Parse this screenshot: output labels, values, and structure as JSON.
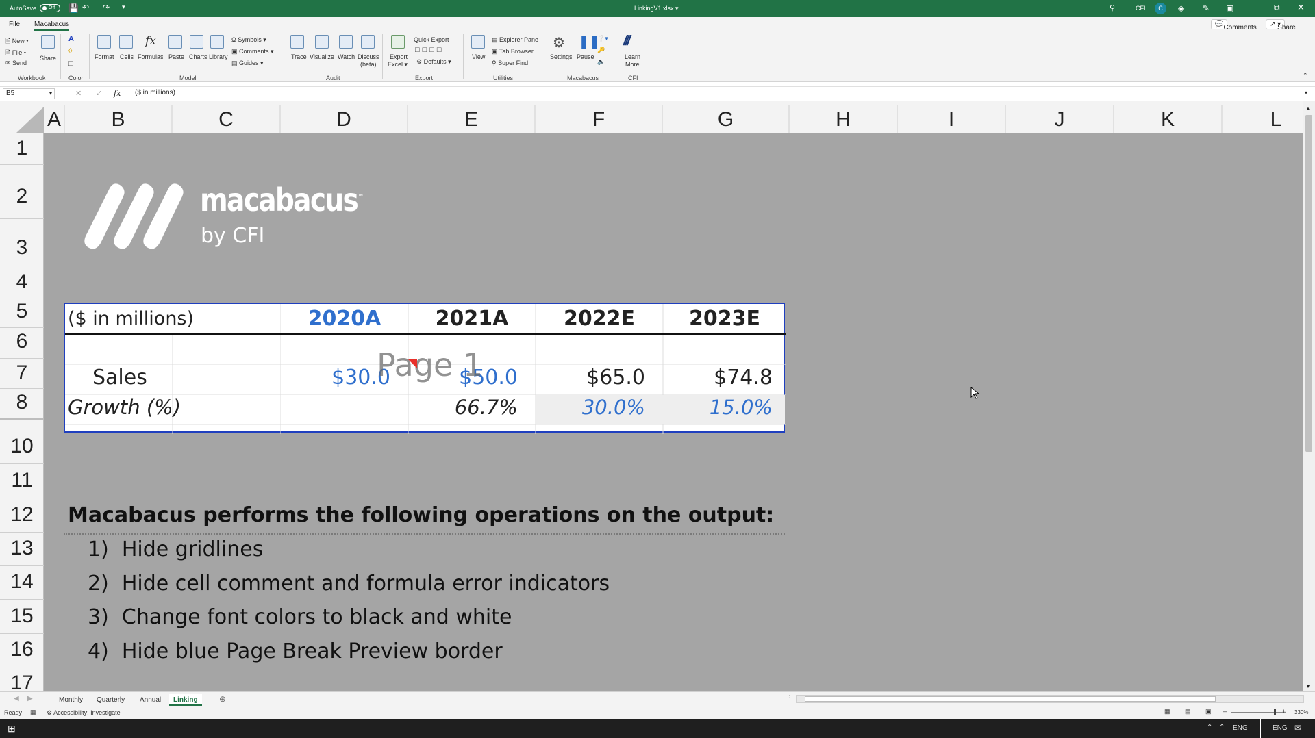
{
  "titlebar": {
    "autosave_label": "AutoSave",
    "autosave_state": "Off",
    "filename": "LinkingV1.xlsx",
    "user_initials": "CFI",
    "avatar_letter": "C"
  },
  "menu": {
    "tabs": [
      "File",
      "Macabacus"
    ],
    "comments_label": "Comments",
    "share_label": "Share"
  },
  "ribbon": {
    "workbook": {
      "new": "New",
      "file": "File",
      "send": "Send",
      "share": "Share",
      "group": "Workbook"
    },
    "color": {
      "group": "Color"
    },
    "model": {
      "format": "Format",
      "cells": "Cells",
      "formulas": "Formulas",
      "paste": "Paste",
      "charts": "Charts",
      "library": "Library",
      "symbols": "Symbols",
      "comments": "Comments",
      "guides": "Guides",
      "group": "Model"
    },
    "audit": {
      "trace": "Trace",
      "visualize": "Visualize",
      "watch": "Watch",
      "discuss": "Discuss",
      "discuss_sub": "(beta)",
      "group": "Audit"
    },
    "export": {
      "export_excel": "Export",
      "export_excel_sub": "Excel",
      "quick_export": "Quick Export",
      "defaults": "Defaults",
      "group": "Export"
    },
    "utilities": {
      "view": "View",
      "explorer_pane": "Explorer Pane",
      "tab_browser": "Tab Browser",
      "super_find": "Super Find",
      "group": "Utilities"
    },
    "macabacus": {
      "settings": "Settings",
      "pause": "Pause",
      "group": "Macabacus"
    },
    "cfi": {
      "learn": "Learn",
      "more": "More",
      "group": "CFI"
    }
  },
  "formula_bar": {
    "name_box": "B5",
    "fx": "fx",
    "formula": "($ in millions)"
  },
  "columns": [
    "A",
    "B",
    "C",
    "D",
    "E",
    "F",
    "G",
    "H",
    "I",
    "J",
    "K",
    "L"
  ],
  "rows": [
    "1",
    "2",
    "3",
    "4",
    "5",
    "6",
    "7",
    "8",
    "10",
    "11",
    "12",
    "13",
    "14",
    "15",
    "16",
    "17"
  ],
  "logo": {
    "brand": "macabacus",
    "tm": "™",
    "byline": "by CFI"
  },
  "table": {
    "header_label": "($ in millions)",
    "years": [
      "2020A",
      "2021A",
      "2022E",
      "2023E"
    ],
    "sales_label": "Sales",
    "sales": [
      "$30.0",
      "$50.0",
      "$65.0",
      "$74.8"
    ],
    "growth_label": "Growth (%)",
    "growth": [
      "",
      "66.7%",
      "30.0%",
      "15.0%"
    ],
    "page_watermark": "Page 1"
  },
  "notes": {
    "heading": "Macabacus performs the following operations on the output:",
    "items": [
      {
        "num": "1)",
        "text": "Hide gridlines"
      },
      {
        "num": "2)",
        "text": "Hide cell comment and formula error indicators"
      },
      {
        "num": "3)",
        "text": "Change font colors to black and white"
      },
      {
        "num": "4)",
        "text": "Hide blue Page Break Preview border"
      }
    ]
  },
  "sheet_tabs": [
    "Monthly",
    "Quarterly",
    "Annual",
    "Linking"
  ],
  "active_sheet": "Linking",
  "status": {
    "ready": "Ready",
    "accessibility": "Accessibility: Investigate",
    "zoom": "330%"
  },
  "taskbar": {
    "lang": "ENG"
  },
  "colors": {
    "excel_green": "#217346",
    "sheet_gray": "#a5a5a5",
    "accent_blue": "#2f6fcd",
    "border_blue": "#1f3fbf"
  }
}
